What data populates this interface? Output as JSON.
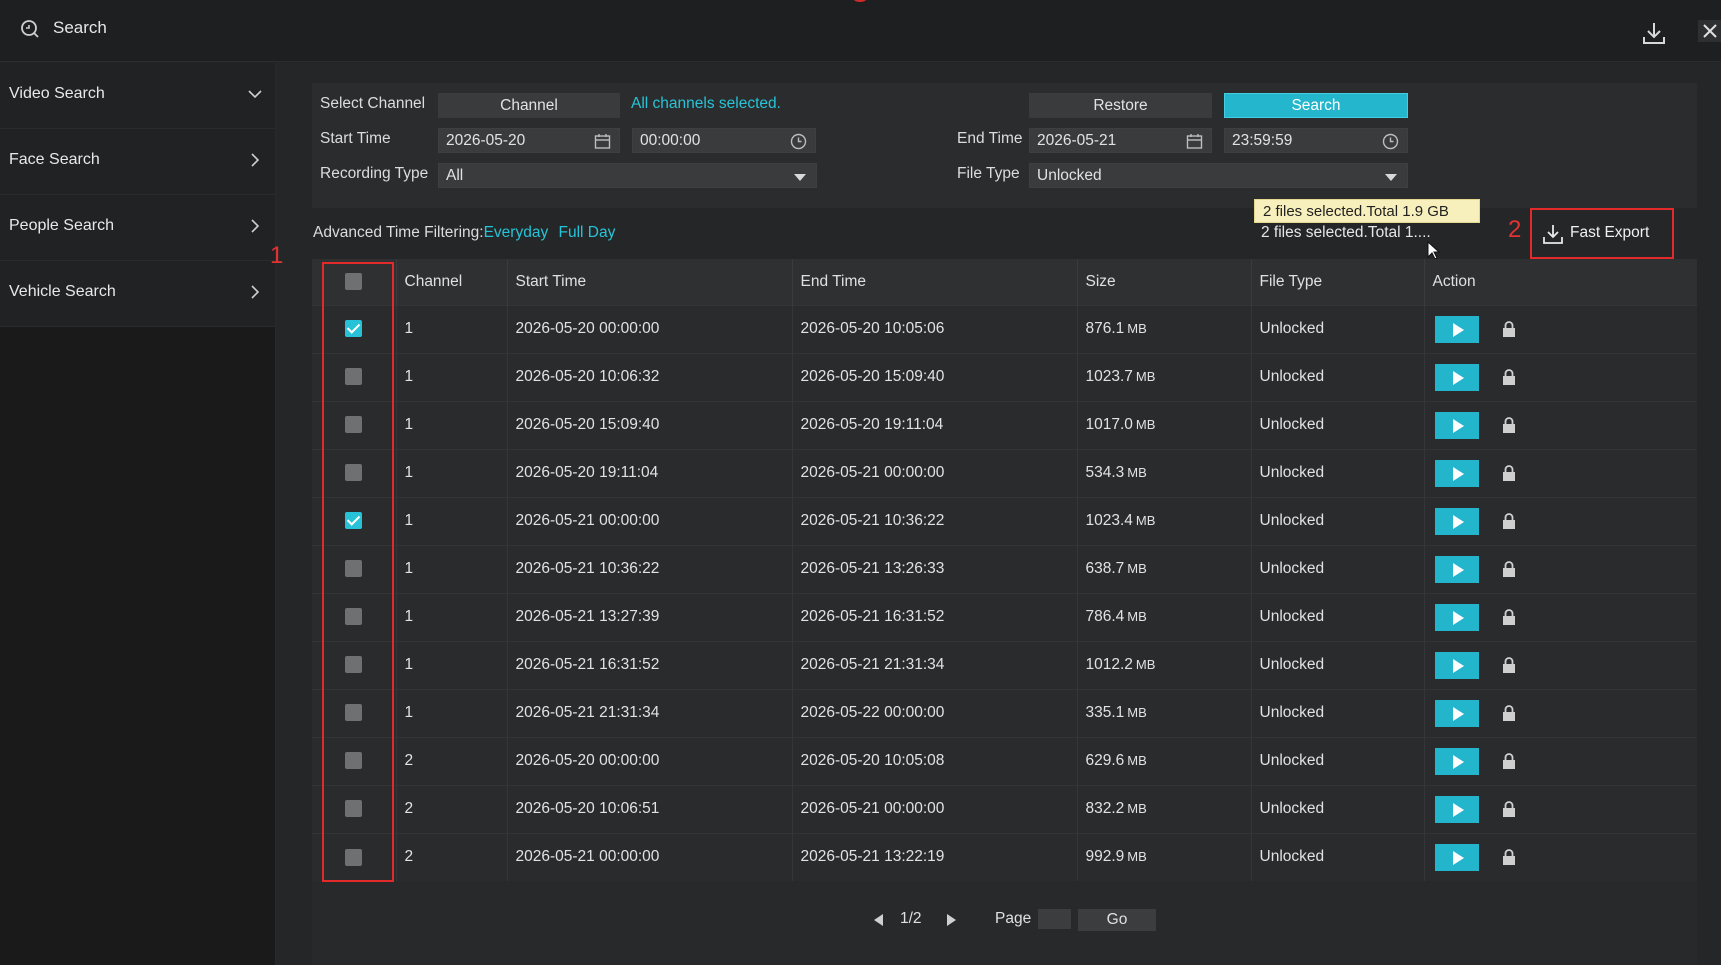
{
  "app": {
    "title": "Search",
    "title_icon": "search-history-icon",
    "download_icon": "download-icon",
    "close_icon": "close-icon"
  },
  "sidebar": {
    "items": [
      {
        "label": "Video Search",
        "icon": "chevron-down-icon",
        "expanded": true
      },
      {
        "label": "Face Search",
        "icon": "chevron-right-icon",
        "expanded": false
      },
      {
        "label": "People Search",
        "icon": "chevron-right-icon",
        "expanded": false
      },
      {
        "label": "Vehicle Search",
        "icon": "chevron-right-icon",
        "expanded": false
      }
    ]
  },
  "filters": {
    "select_channel_label": "Select Channel",
    "channel_button": "Channel",
    "channel_status": "All channels selected.",
    "restore_button": "Restore",
    "search_button": "Search",
    "start_time_label": "Start Time",
    "start_date": "2026-05-20",
    "start_time": "00:00:00",
    "end_time_label": "End Time",
    "end_date": "2026-05-21",
    "end_time": "23:59:59",
    "recording_type_label": "Recording Type",
    "recording_type_value": "All",
    "file_type_label": "File Type",
    "file_type_value": "Unlocked"
  },
  "advanced": {
    "label": "Advanced Time Filtering:",
    "everyday": "Everyday",
    "full_day": "Full Day"
  },
  "selection": {
    "tooltip": "2 files selected.Total 1.9 GB",
    "summary": "2 files selected.Total 1...."
  },
  "fast_export": {
    "label": "Fast Export",
    "icon": "download-icon"
  },
  "annotations": {
    "marker_1": "1",
    "marker_2": "2"
  },
  "table": {
    "headers": [
      "Channel",
      "Start Time",
      "End Time",
      "Size",
      "File Type",
      "Action"
    ],
    "size_unit": "MB",
    "rows": [
      {
        "checked": true,
        "channel": "1",
        "start": "2026-05-20 00:00:00",
        "end": "2026-05-20 10:05:06",
        "size": "876.1",
        "type": "Unlocked"
      },
      {
        "checked": false,
        "channel": "1",
        "start": "2026-05-20 10:06:32",
        "end": "2026-05-20 15:09:40",
        "size": "1023.7",
        "type": "Unlocked"
      },
      {
        "checked": false,
        "channel": "1",
        "start": "2026-05-20 15:09:40",
        "end": "2026-05-20 19:11:04",
        "size": "1017.0",
        "type": "Unlocked"
      },
      {
        "checked": false,
        "channel": "1",
        "start": "2026-05-20 19:11:04",
        "end": "2026-05-21 00:00:00",
        "size": "534.3",
        "type": "Unlocked"
      },
      {
        "checked": true,
        "channel": "1",
        "start": "2026-05-21 00:00:00",
        "end": "2026-05-21 10:36:22",
        "size": "1023.4",
        "type": "Unlocked"
      },
      {
        "checked": false,
        "channel": "1",
        "start": "2026-05-21 10:36:22",
        "end": "2026-05-21 13:26:33",
        "size": "638.7",
        "type": "Unlocked"
      },
      {
        "checked": false,
        "channel": "1",
        "start": "2026-05-21 13:27:39",
        "end": "2026-05-21 16:31:52",
        "size": "786.4",
        "type": "Unlocked"
      },
      {
        "checked": false,
        "channel": "1",
        "start": "2026-05-21 16:31:52",
        "end": "2026-05-21 21:31:34",
        "size": "1012.2",
        "type": "Unlocked"
      },
      {
        "checked": false,
        "channel": "1",
        "start": "2026-05-21 21:31:34",
        "end": "2026-05-22 00:00:00",
        "size": "335.1",
        "type": "Unlocked"
      },
      {
        "checked": false,
        "channel": "2",
        "start": "2026-05-20 00:00:00",
        "end": "2026-05-20 10:05:08",
        "size": "629.6",
        "type": "Unlocked"
      },
      {
        "checked": false,
        "channel": "2",
        "start": "2026-05-20 10:06:51",
        "end": "2026-05-21 00:00:00",
        "size": "832.2",
        "type": "Unlocked"
      },
      {
        "checked": false,
        "channel": "2",
        "start": "2026-05-21 00:00:00",
        "end": "2026-05-21 13:22:19",
        "size": "992.9",
        "type": "Unlocked"
      }
    ]
  },
  "pager": {
    "page_indicator": "1/2",
    "page_label": "Page",
    "page_input": "",
    "go_button": "Go"
  },
  "colors": {
    "accent": "#24b6cc",
    "highlight_box": "#e22a2a",
    "background": "#222324"
  }
}
